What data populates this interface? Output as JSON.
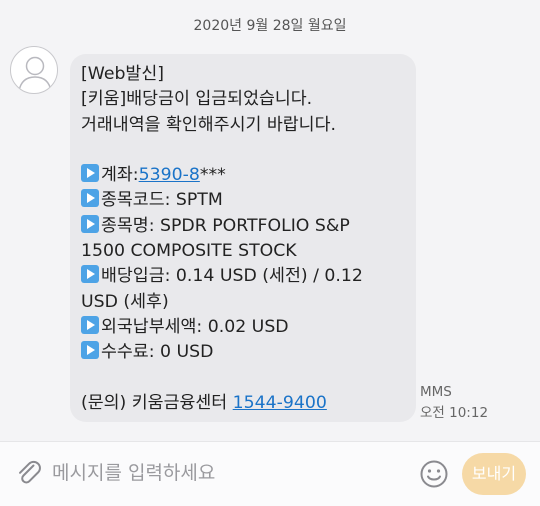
{
  "date_header": "2020년 9월 28일 월요일",
  "message": {
    "lines": [
      "[Web발신]",
      "[키움]배당금이 입금되었습니다.",
      "거래내역을 확인해주시기 바랍니다."
    ],
    "account_label": "계좌:",
    "account_link": "5390-8",
    "account_suffix": "***",
    "stock_code": "종목코드: SPTM",
    "stock_name_1": "종목명: SPDR PORTFOLIO S&P",
    "stock_name_2": "1500 COMPOSITE STOCK",
    "dividend_1": "배당입금: 0.14 USD (세전) / 0.12",
    "dividend_2": "USD (세후)",
    "foreign_tax": "외국납부세액: 0.02 USD",
    "fee": "수수료: 0 USD",
    "inquiry_text": "(문의) 키움금융센터 ",
    "inquiry_phone": "1544-9400"
  },
  "meta": {
    "type": "MMS",
    "time": "오전 10:12"
  },
  "input": {
    "placeholder": "메시지를 입력하세요"
  },
  "send_label": "보내기",
  "icons": {
    "attach": "paperclip-icon",
    "emoji": "smiley-icon",
    "bullet": "play-button-icon"
  },
  "colors": {
    "link": "#1a73c8",
    "bullet": "#4da3e6",
    "send_button": "#f6d9a6",
    "bubble": "#e9e9ec"
  }
}
